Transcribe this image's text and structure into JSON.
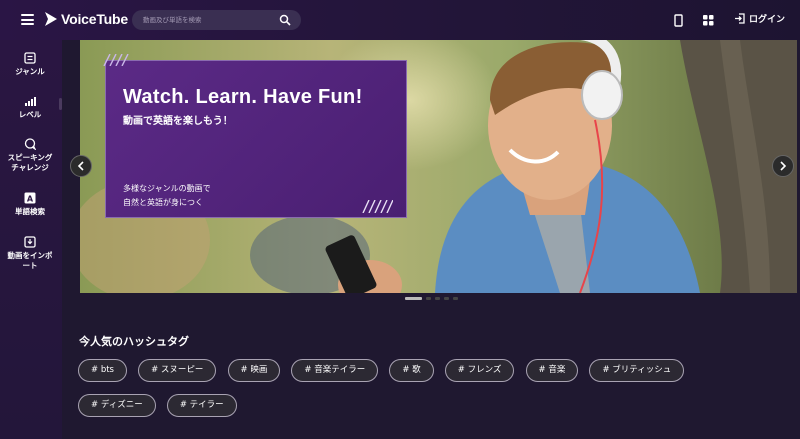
{
  "header": {
    "logo_text": "VoiceTube",
    "search_placeholder": "動画及び単語を検索",
    "login_label": "ログイン"
  },
  "sidebar": {
    "items": [
      {
        "label": "ジャンル",
        "icon": "genre-icon"
      },
      {
        "label": "レベル",
        "icon": "level-bars-icon"
      },
      {
        "label": "スピーキングチャレンジ",
        "line1": "スピーキング",
        "line2": "チャレンジ",
        "icon": "speech-bubble-icon"
      },
      {
        "label": "単語検索",
        "icon": "dictionary-icon"
      },
      {
        "label": "動画をインポート",
        "line1": "動画をインポ",
        "line2": "ート",
        "icon": "import-icon"
      }
    ]
  },
  "hero": {
    "title": "Watch. Learn. Have Fun!",
    "subtitle": "動画で英語を楽しもう！",
    "body_line1": "多様なジャンルの動画で",
    "body_line2": "自然と英語が身につく",
    "slide_count": 5,
    "active_slide": 1
  },
  "hashtags": {
    "title": "今人気のハッシュタグ",
    "tags": [
      "# bts",
      "# スヌーピー",
      "# 映画",
      "# 音楽テイラー",
      "# 歌",
      "# フレンズ",
      "# 音楽",
      "# ブリティッシュ",
      "# ディズニー",
      "# テイラー"
    ]
  },
  "colors": {
    "topbar": "#2a1545",
    "sidebar": "#2a1642",
    "body": "#1f1830",
    "promo": "#5b2a86"
  }
}
